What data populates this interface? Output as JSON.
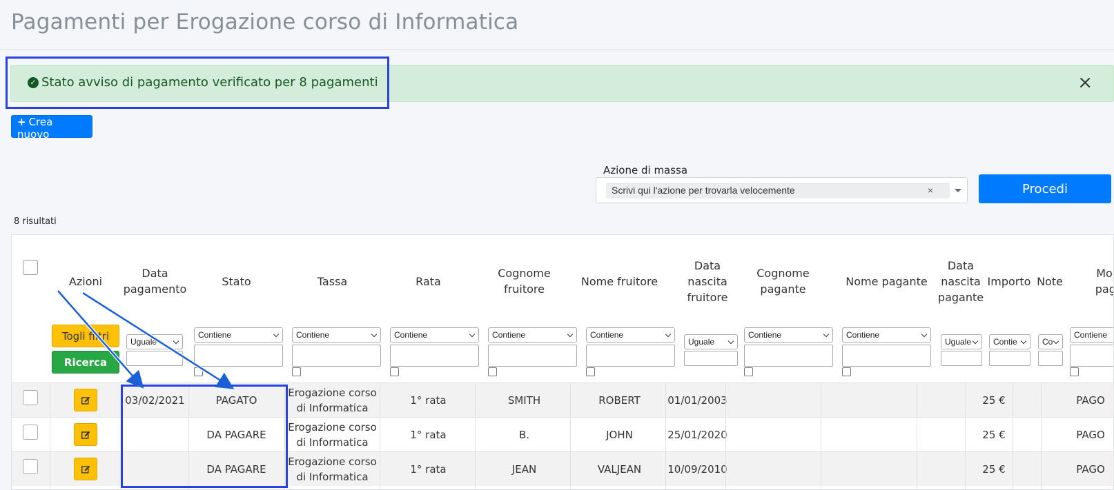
{
  "page": {
    "title": "Pagamenti per Erogazione corso di Informatica"
  },
  "alert": {
    "icon": "check-circle-icon",
    "message": "Stato avviso di pagamento verificato per 8 pagamenti",
    "close": "×"
  },
  "toolbar": {
    "new_label": "Crea nuovo",
    "new_icon": "+"
  },
  "mass_action": {
    "label": "Azione di massa",
    "selected": "Scrivi qui l'azione per trovarla velocemente",
    "clear": "×",
    "proceed_label": "Procedi"
  },
  "results": {
    "count_label": "8 risultati"
  },
  "table": {
    "headers": {
      "azioni": "Azioni",
      "data_pagamento": "Data pagamento",
      "stato": "Stato",
      "tassa": "Tassa",
      "rata": "Rata",
      "cognome_fruitore": "Cognome fruitore",
      "nome_fruitore": "Nome fruitore",
      "data_nascita_fruitore": "Data nascita fruitore",
      "cognome_pagante": "Cognome pagante",
      "nome_pagante": "Nome pagante",
      "data_nascita_pagante": "Data nascita pagante",
      "importo": "Importo",
      "note": "Note",
      "modalita": "Moda pagar"
    },
    "filters": {
      "togli_filtri": "Togli filtri",
      "ricerca": "Ricerca",
      "uguale": "Uguale",
      "contiene": "Contiene",
      "contie": "Contie",
      "co": "Co"
    },
    "rows": [
      {
        "data_pagamento": "03/02/2021",
        "stato": "PAGATO",
        "tassa": "Erogazione corso di Informatica",
        "rata": "1° rata",
        "cognome_fruitore": "SMITH",
        "nome_fruitore": "ROBERT",
        "data_nascita_fruitore": "01/01/2003",
        "importo": "25 €",
        "modalita": "PAGO"
      },
      {
        "data_pagamento": "",
        "stato": "DA PAGARE",
        "tassa": "Erogazione corso di Informatica",
        "rata": "1° rata",
        "cognome_fruitore": "B.",
        "nome_fruitore": "JOHN",
        "data_nascita_fruitore": "25/01/2020",
        "importo": "25 €",
        "modalita": "PAGO"
      },
      {
        "data_pagamento": "",
        "stato": "DA PAGARE",
        "tassa": "Erogazione corso di Informatica",
        "rata": "1° rata",
        "cognome_fruitore": "JEAN",
        "nome_fruitore": "VALJEAN",
        "data_nascita_fruitore": "10/09/2010",
        "importo": "25 €",
        "modalita": "PAGO"
      }
    ]
  },
  "colors": {
    "primary": "#007bff",
    "warning": "#ffc107",
    "success": "#28a745",
    "alert_bg": "#d4edda",
    "highlight": "#2741e0"
  }
}
